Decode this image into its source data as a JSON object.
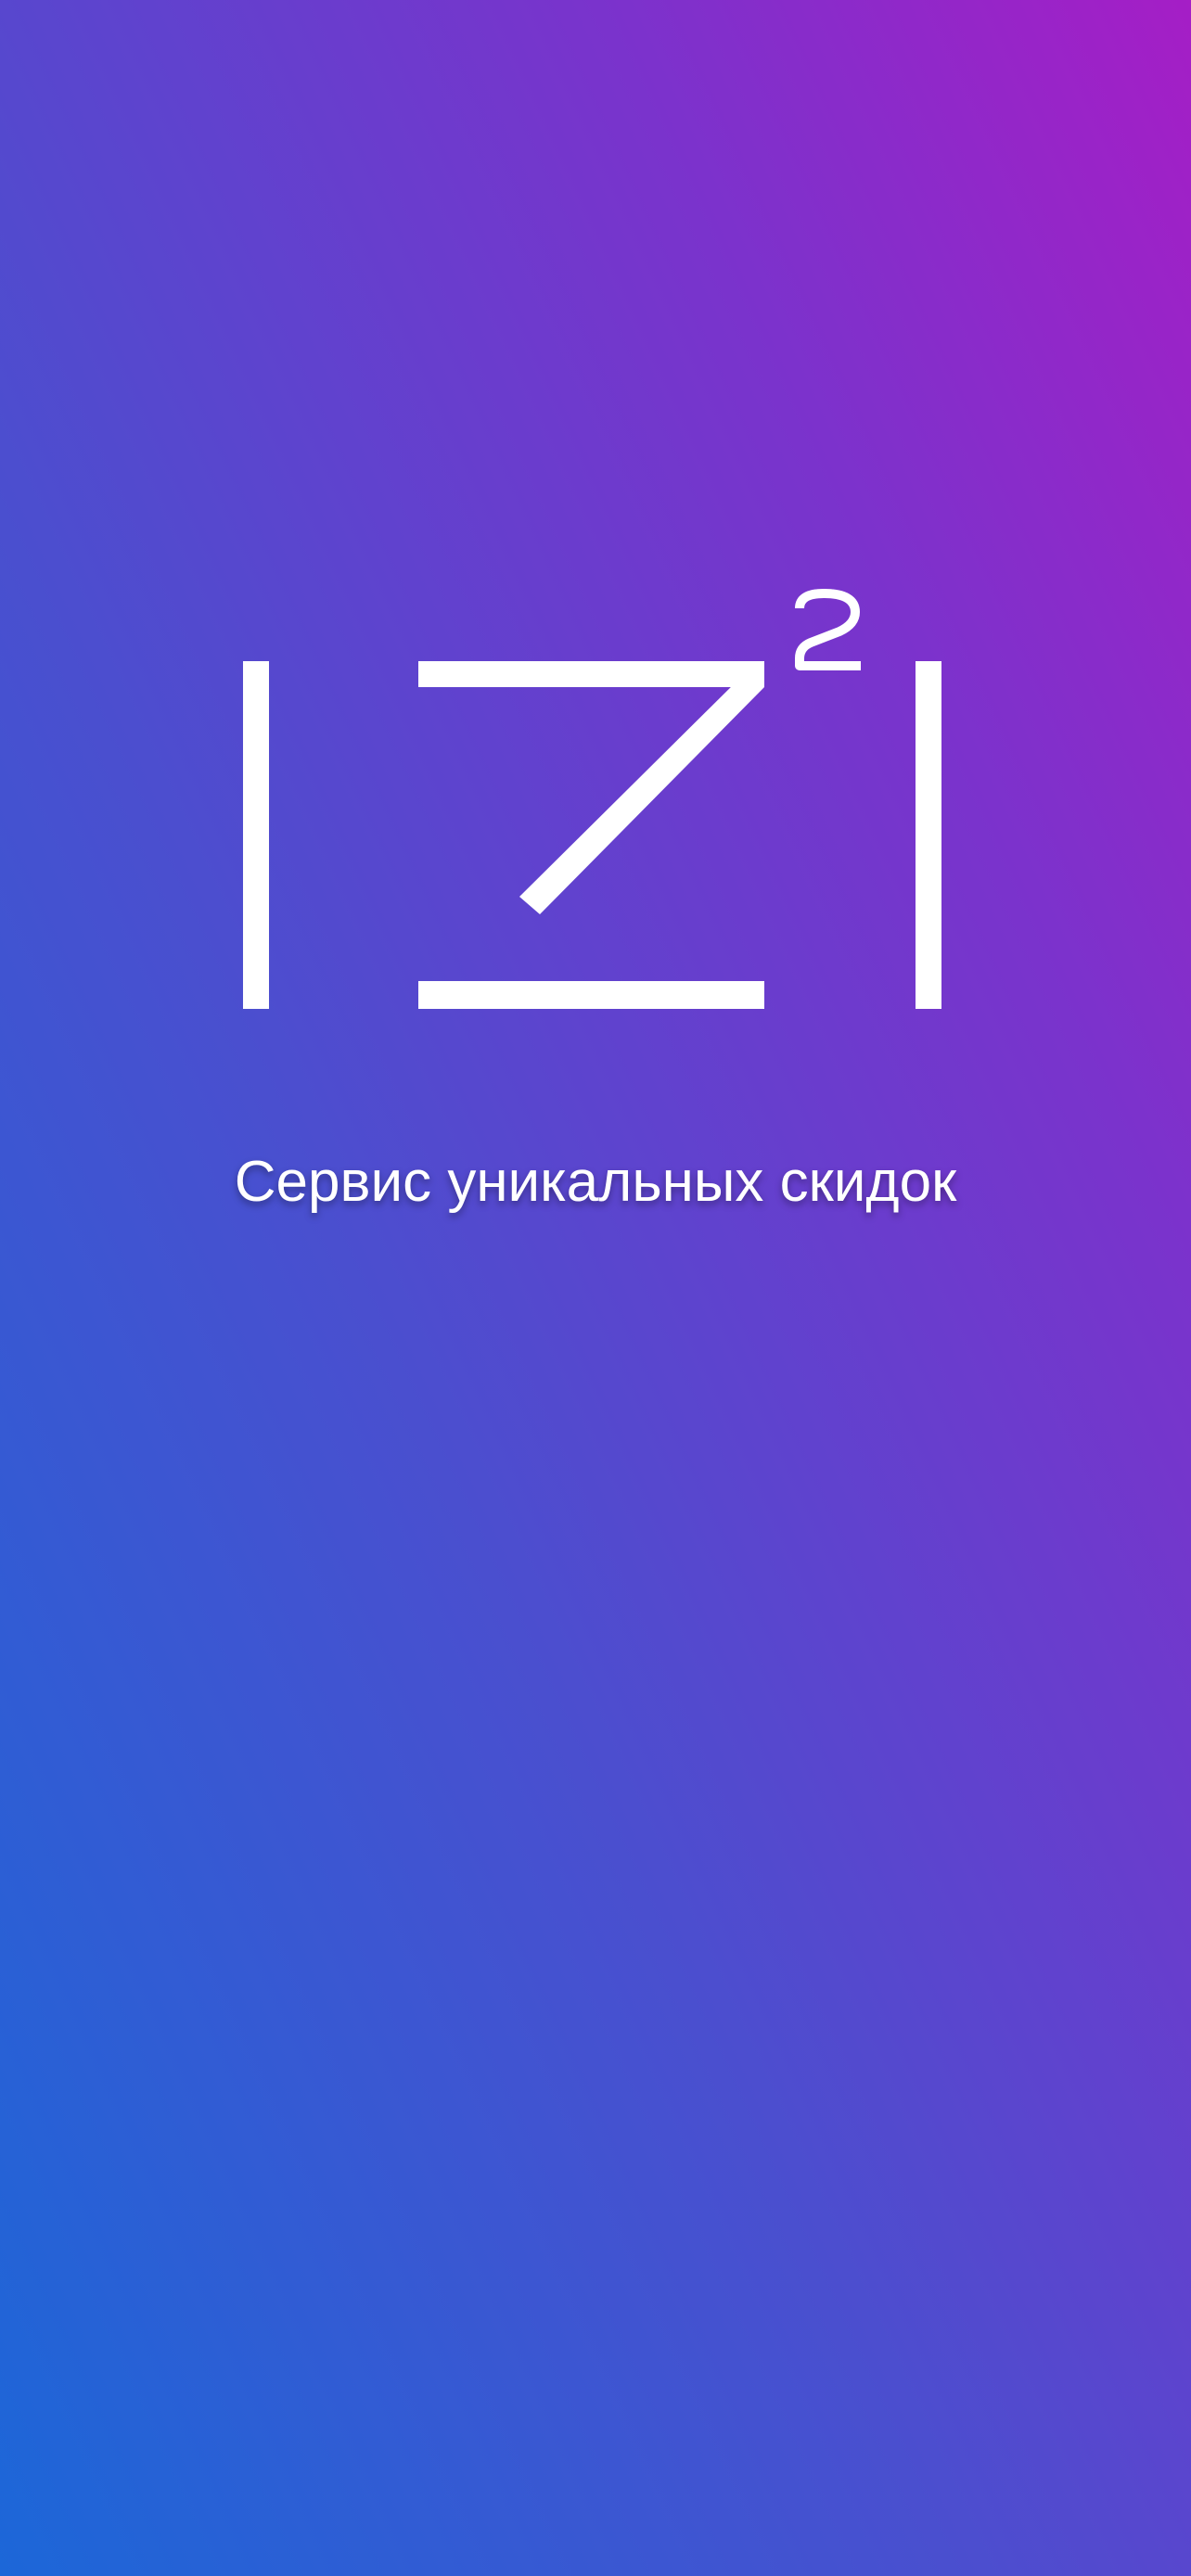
{
  "app": {
    "logo_name": "izi-squared-logo",
    "tagline": "Сервис уникальных скидок"
  },
  "colors": {
    "gradient_bottom_left": "#1c67d8",
    "gradient_middle": "#5a46ce",
    "gradient_top_right": "#a51ec6",
    "foreground": "#ffffff"
  }
}
